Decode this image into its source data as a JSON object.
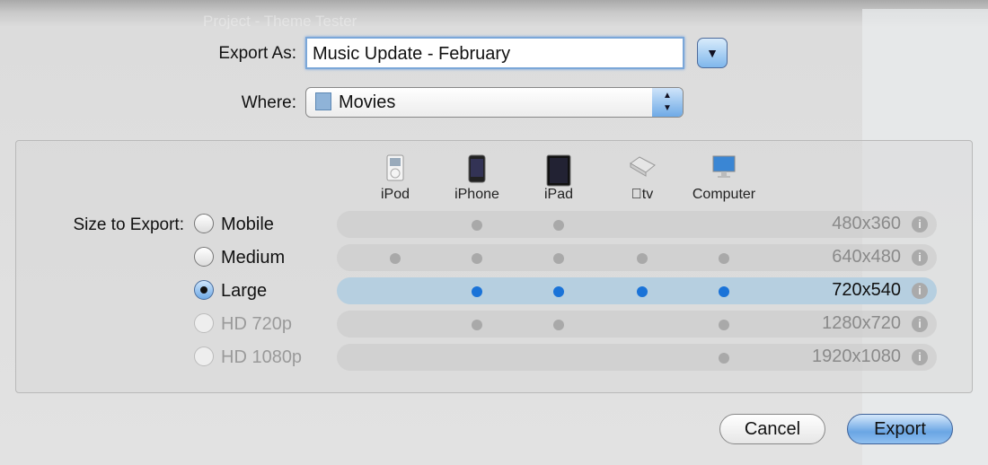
{
  "background_title": "Project - Theme Tester",
  "export_as": {
    "label": "Export As:",
    "value": "Music Update - February"
  },
  "where": {
    "label": "Where:",
    "value": "Movies",
    "icon": "folder-icon"
  },
  "size_label": "Size to Export:",
  "devices": [
    {
      "name": "iPod",
      "icon": "ipod-icon"
    },
    {
      "name": "iPhone",
      "icon": "iphone-icon"
    },
    {
      "name": "iPad",
      "icon": "ipad-icon"
    },
    {
      "name": "tv",
      "icon": "appletv-icon"
    },
    {
      "name": "Computer",
      "icon": "computer-icon"
    }
  ],
  "sizes": [
    {
      "label": "Mobile",
      "resolution": "480x360",
      "selected": false,
      "enabled": true,
      "devices": [
        false,
        true,
        true,
        false,
        false
      ]
    },
    {
      "label": "Medium",
      "resolution": "640x480",
      "selected": false,
      "enabled": true,
      "devices": [
        true,
        true,
        true,
        true,
        true
      ]
    },
    {
      "label": "Large",
      "resolution": "720x540",
      "selected": true,
      "enabled": true,
      "devices": [
        false,
        true,
        true,
        true,
        true
      ]
    },
    {
      "label": "HD 720p",
      "resolution": "1280x720",
      "selected": false,
      "enabled": false,
      "devices": [
        false,
        true,
        true,
        false,
        true
      ]
    },
    {
      "label": "HD 1080p",
      "resolution": "1920x1080",
      "selected": false,
      "enabled": false,
      "devices": [
        false,
        false,
        false,
        false,
        true
      ]
    }
  ],
  "buttons": {
    "cancel": "Cancel",
    "export": "Export"
  },
  "colors": {
    "accent": "#1a73d8",
    "selected_row": "#b6cfe0"
  }
}
